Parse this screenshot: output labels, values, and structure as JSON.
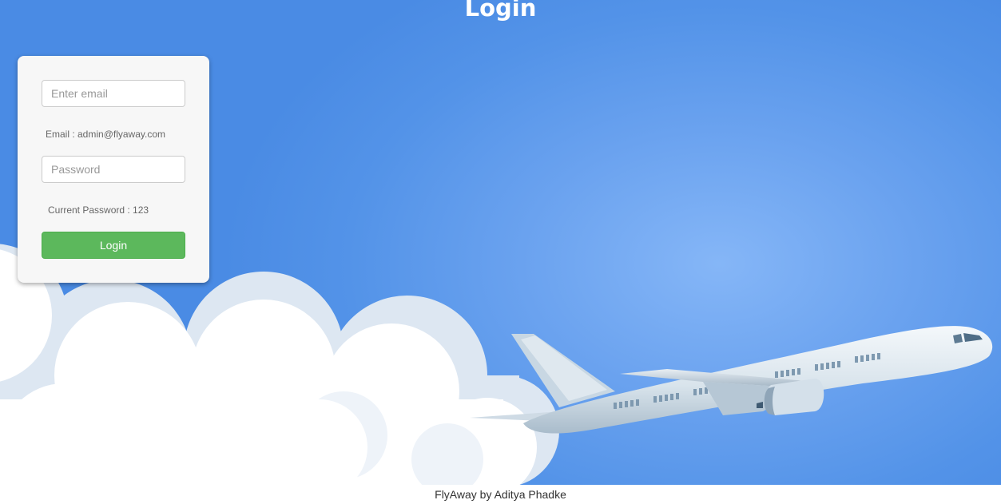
{
  "page": {
    "title": "Login"
  },
  "login_form": {
    "email_placeholder": "Enter email",
    "email_hint": "Email : admin@flyaway.com",
    "password_placeholder": "Password",
    "password_hint": "Current Password : 123",
    "login_button_label": "Login"
  },
  "footer": {
    "text": "FlyAway by Aditya Phadke"
  },
  "colors": {
    "sky_blue": "#5393e8",
    "button_green": "#5cb85c",
    "card_background": "#f7f7f7"
  },
  "background": {
    "illustration": [
      "cloud-illustration",
      "airplane-illustration"
    ]
  }
}
